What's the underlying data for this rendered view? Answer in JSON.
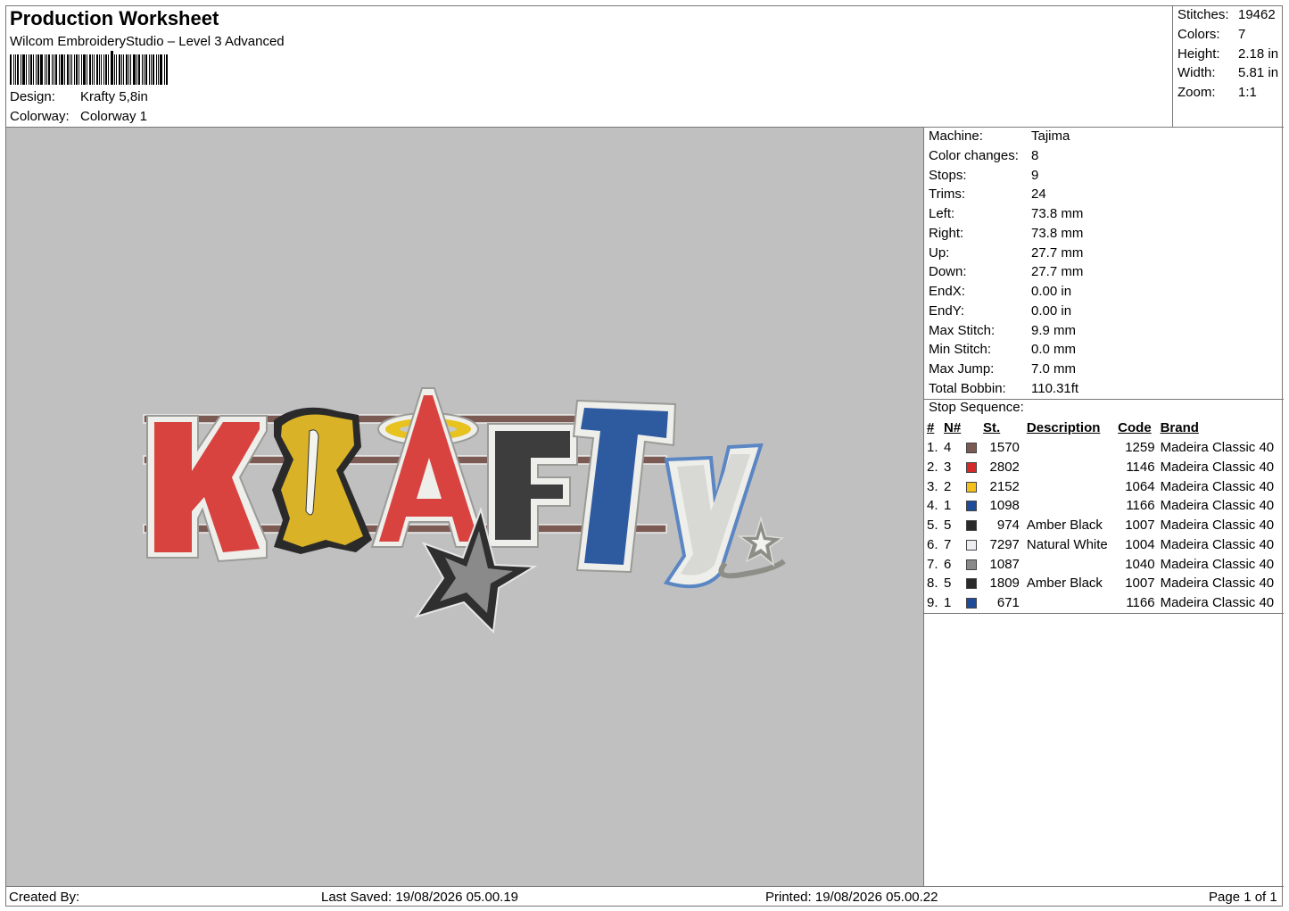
{
  "header": {
    "title": "Production Worksheet",
    "software": "Wilcom EmbroideryStudio – Level 3 Advanced",
    "design_label": "Design:",
    "design_value": "Krafty 5,8in",
    "colorway_label": "Colorway:",
    "colorway_value": "Colorway 1"
  },
  "stats": {
    "stitches_label": "Stitches:",
    "stitches": "19462",
    "colors_label": "Colors:",
    "colors": "7",
    "height_label": "Height:",
    "height": "2.18 in",
    "width_label": "Width:",
    "width": "5.81 in",
    "zoom_label": "Zoom:",
    "zoom": "1:1"
  },
  "machine": [
    {
      "label": "Machine:",
      "value": "Tajima"
    },
    {
      "label": "Color changes:",
      "value": "8"
    },
    {
      "label": "Stops:",
      "value": "9"
    },
    {
      "label": "Trims:",
      "value": "24"
    },
    {
      "label": "Left:",
      "value": "73.8 mm"
    },
    {
      "label": "Right:",
      "value": "73.8 mm"
    },
    {
      "label": "Up:",
      "value": "27.7 mm"
    },
    {
      "label": "Down:",
      "value": "27.7 mm"
    },
    {
      "label": "EndX:",
      "value": "0.00 in"
    },
    {
      "label": "EndY:",
      "value": "0.00 in"
    },
    {
      "label": "Max Stitch:",
      "value": "9.9 mm"
    },
    {
      "label": "Min Stitch:",
      "value": "0.0 mm"
    },
    {
      "label": "Max Jump:",
      "value": "7.0 mm"
    },
    {
      "label": "Total Bobbin:",
      "value": "110.31ft"
    }
  ],
  "sequence": {
    "title": "Stop Sequence:",
    "headers": {
      "idx": "#",
      "n": "N#",
      "st": "St.",
      "desc": "Description",
      "code": "Code",
      "brand": "Brand"
    },
    "rows": [
      {
        "idx": "1.",
        "n": "4",
        "color": "#7a5a52",
        "st": "1570",
        "desc": "",
        "code": "1259",
        "brand": "Madeira Classic 40"
      },
      {
        "idx": "2.",
        "n": "3",
        "color": "#d42a2a",
        "st": "2802",
        "desc": "",
        "code": "1146",
        "brand": "Madeira Classic 40"
      },
      {
        "idx": "3.",
        "n": "2",
        "color": "#f2c21a",
        "st": "2152",
        "desc": "",
        "code": "1064",
        "brand": "Madeira Classic 40"
      },
      {
        "idx": "4.",
        "n": "1",
        "color": "#1f4b99",
        "st": "1098",
        "desc": "",
        "code": "1166",
        "brand": "Madeira Classic 40"
      },
      {
        "idx": "5.",
        "n": "5",
        "color": "#2a2a2a",
        "st": "974",
        "desc": "Amber Black",
        "code": "1007",
        "brand": "Madeira Classic 40"
      },
      {
        "idx": "6.",
        "n": "7",
        "color": "#eeeef2",
        "st": "7297",
        "desc": "Natural White",
        "code": "1004",
        "brand": "Madeira Classic 40"
      },
      {
        "idx": "7.",
        "n": "6",
        "color": "#8a8a8a",
        "st": "1087",
        "desc": "",
        "code": "1040",
        "brand": "Madeira Classic 40"
      },
      {
        "idx": "8.",
        "n": "5",
        "color": "#2a2a2a",
        "st": "1809",
        "desc": "Amber Black",
        "code": "1007",
        "brand": "Madeira Classic 40"
      },
      {
        "idx": "9.",
        "n": "1",
        "color": "#1f4b99",
        "st": "671",
        "desc": "",
        "code": "1166",
        "brand": "Madeira Classic 40"
      }
    ]
  },
  "footer": {
    "created_by": "Created By:",
    "last_saved": "Last Saved: 19/08/2026 05.00.19",
    "printed": "Printed: 19/08/2026 05.00.22",
    "page": "Page 1 of 1"
  },
  "artwork": {
    "letters": [
      "K",
      "R",
      "A",
      "F",
      "T",
      "y"
    ],
    "background_color": "#c0c0c0"
  }
}
